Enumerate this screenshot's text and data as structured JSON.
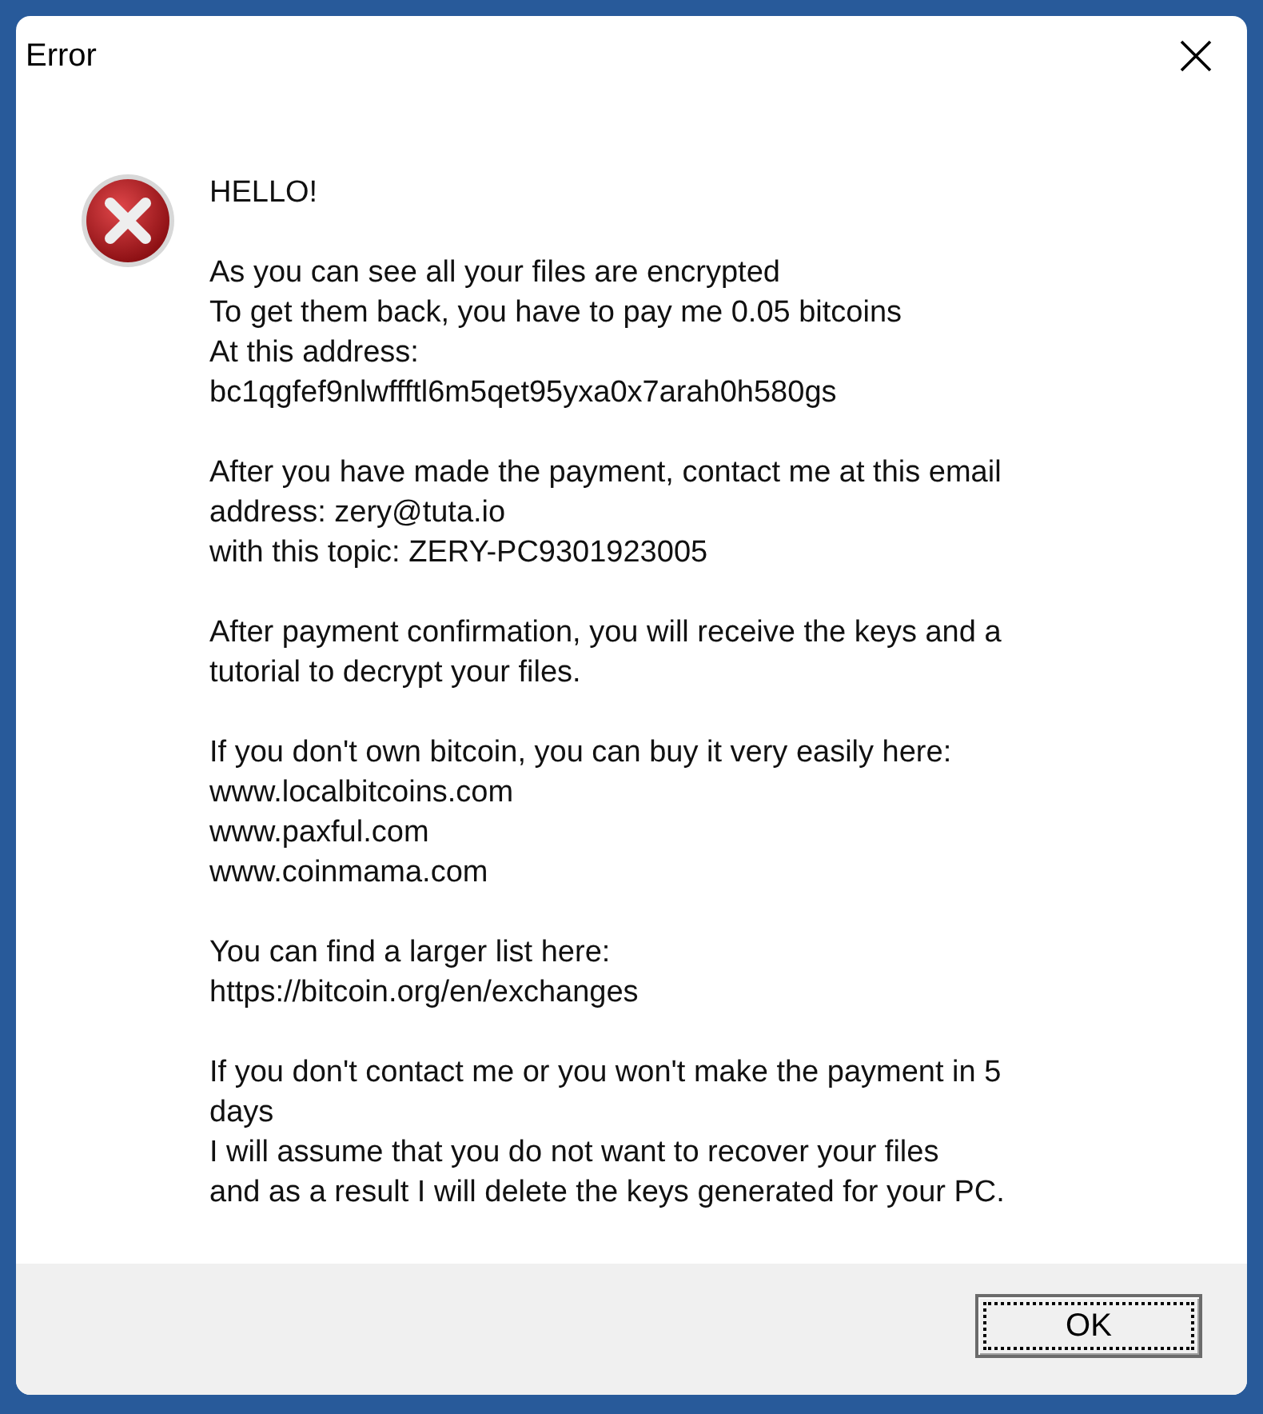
{
  "window": {
    "title": "Error"
  },
  "message": [
    [
      "HELLO!"
    ],
    [
      "As you can see all your files are encrypted",
      "To get them back, you have to pay me 0.05 bitcoins",
      "At this address:",
      "bc1qgfef9nlwffftl6m5qet95yxa0x7arah0h580gs"
    ],
    [
      "After you have made the payment, contact me at this email",
      "address: zery@tuta.io",
      "with this topic: ZERY-PC9301923005"
    ],
    [
      "After payment confirmation, you will receive the keys and a",
      "tutorial to decrypt your files."
    ],
    [
      "If you don't own bitcoin, you can buy it very easily here:",
      "www.localbitcoins.com",
      "www.paxful.com",
      "www.coinmama.com"
    ],
    [
      "You can find a larger list here:",
      "https://bitcoin.org/en/exchanges"
    ],
    [
      "If you don't contact me or you won't make the payment in 5",
      "days",
      "I will assume that you do not want to recover your files",
      "and as a result I will delete the keys generated for your PC."
    ]
  ],
  "buttons": [
    {
      "label": "OK",
      "focused": true
    }
  ]
}
